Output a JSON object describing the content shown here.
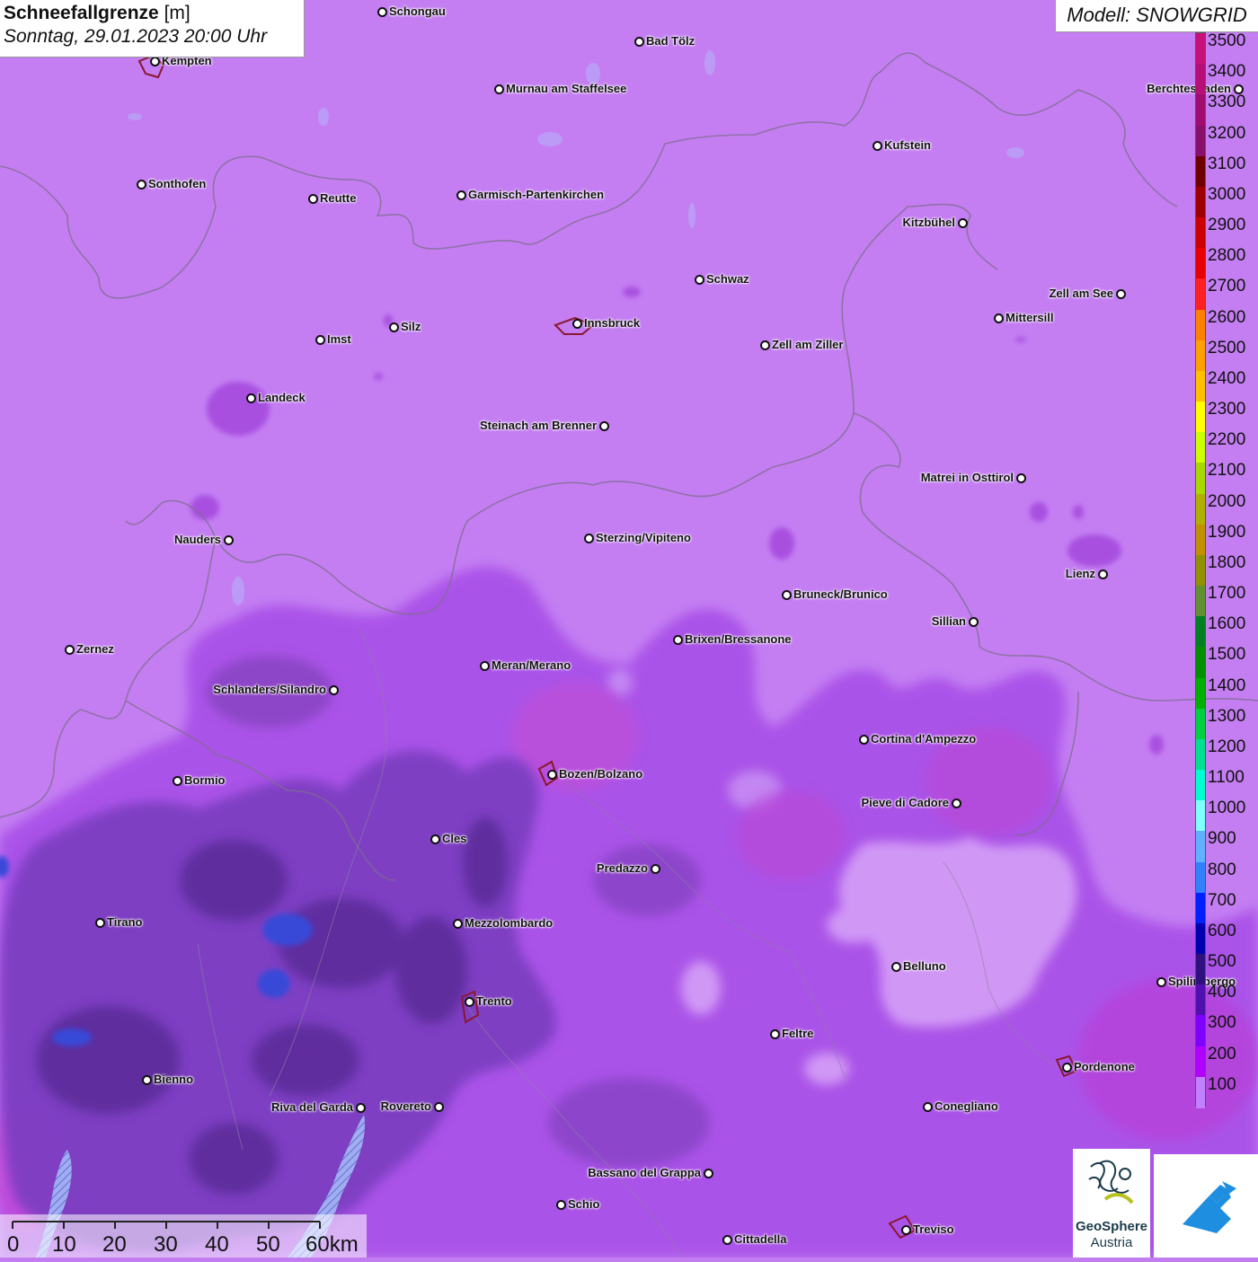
{
  "title": {
    "variable": "Schneefallgrenze",
    "unit": "[m]",
    "datetime": "Sonntag, 29.01.2023 20:00 Uhr"
  },
  "model_label": "Modell: SNOWGRID",
  "legend": {
    "values": [
      3500,
      3400,
      3300,
      3200,
      3100,
      3000,
      2900,
      2800,
      2700,
      2600,
      2500,
      2400,
      2300,
      2200,
      2100,
      2000,
      1900,
      1800,
      1700,
      1600,
      1500,
      1400,
      1300,
      1200,
      1100,
      1000,
      900,
      800,
      700,
      600,
      500,
      400,
      300,
      200,
      100
    ],
    "colors": [
      "#c8107a",
      "#b80e78",
      "#a00c70",
      "#88106a",
      "#6e0000",
      "#9e0000",
      "#cc0000",
      "#e80000",
      "#ff2020",
      "#ff8000",
      "#ffa000",
      "#ffc000",
      "#ffff00",
      "#ccff00",
      "#a8d800",
      "#b0b000",
      "#c09000",
      "#909000",
      "#609030",
      "#008020",
      "#009000",
      "#00b000",
      "#00d040",
      "#00e090",
      "#00ffd0",
      "#80ffff",
      "#60b0ff",
      "#3080ff",
      "#0020ff",
      "#0000b0",
      "#301080",
      "#5010b0",
      "#8000ff",
      "#b000ff",
      "#c080ff"
    ]
  },
  "cities": [
    {
      "name": "Schongau",
      "side": "right"
    },
    {
      "name": "Bad Tölz",
      "side": "right"
    },
    {
      "name": "Kempten",
      "side": "right"
    },
    {
      "name": "Murnau am Staffelsee",
      "side": "right"
    },
    {
      "name": "Berchtesgaden",
      "side": "left"
    },
    {
      "name": "Kufstein",
      "side": "right"
    },
    {
      "name": "Sonthofen",
      "side": "right"
    },
    {
      "name": "Reutte",
      "side": "right"
    },
    {
      "name": "Garmisch-Partenkirchen",
      "side": "right"
    },
    {
      "name": "Kitzbühel",
      "side": "left"
    },
    {
      "name": "Schwaz",
      "side": "right"
    },
    {
      "name": "Zell am See",
      "side": "left"
    },
    {
      "name": "Innsbruck",
      "side": "right"
    },
    {
      "name": "Mittersill",
      "side": "right"
    },
    {
      "name": "Silz",
      "side": "right"
    },
    {
      "name": "Imst",
      "side": "right"
    },
    {
      "name": "Zell am Ziller",
      "side": "right"
    },
    {
      "name": "Landeck",
      "side": "right"
    },
    {
      "name": "Steinach am Brenner",
      "side": "left"
    },
    {
      "name": "Matrei in Osttirol",
      "side": "left"
    },
    {
      "name": "Nauders",
      "side": "left"
    },
    {
      "name": "Sterzing/Vipiteno",
      "side": "right"
    },
    {
      "name": "Lienz",
      "side": "left"
    },
    {
      "name": "Bruneck/Brunico",
      "side": "right"
    },
    {
      "name": "Sillian",
      "side": "left"
    },
    {
      "name": "Zernez",
      "side": "right"
    },
    {
      "name": "Brixen/Bressanone",
      "side": "right"
    },
    {
      "name": "Meran/Merano",
      "side": "right"
    },
    {
      "name": "Schlanders/Silandro",
      "side": "left"
    },
    {
      "name": "Cortina d'Ampezzo",
      "side": "right"
    },
    {
      "name": "Bozen/Bolzano",
      "side": "right"
    },
    {
      "name": "Bormio",
      "side": "right"
    },
    {
      "name": "Pieve di Cadore",
      "side": "left"
    },
    {
      "name": "Cles",
      "side": "right"
    },
    {
      "name": "Predazzo",
      "side": "left"
    },
    {
      "name": "Tirano",
      "side": "right"
    },
    {
      "name": "Mezzolombardo",
      "side": "right"
    },
    {
      "name": "Belluno",
      "side": "right"
    },
    {
      "name": "Spilimbergo",
      "side": "right"
    },
    {
      "name": "Trento",
      "side": "right"
    },
    {
      "name": "Feltre",
      "side": "right"
    },
    {
      "name": "Pordenone",
      "side": "right"
    },
    {
      "name": "Bienno",
      "side": "right"
    },
    {
      "name": "Riva del Garda",
      "side": "left"
    },
    {
      "name": "Rovereto",
      "side": "left"
    },
    {
      "name": "Conegliano",
      "side": "right"
    },
    {
      "name": "Bassano del Grappa",
      "side": "left"
    },
    {
      "name": "Schio",
      "side": "right"
    },
    {
      "name": "Treviso",
      "side": "right"
    },
    {
      "name": "Cittadella",
      "side": "right"
    }
  ],
  "scale": {
    "ticks": [
      "0",
      "10",
      "20",
      "30",
      "40",
      "50",
      "60km"
    ]
  },
  "logos": {
    "geosphere_name": "GeoSphere",
    "geosphere_sub": "Austria"
  }
}
